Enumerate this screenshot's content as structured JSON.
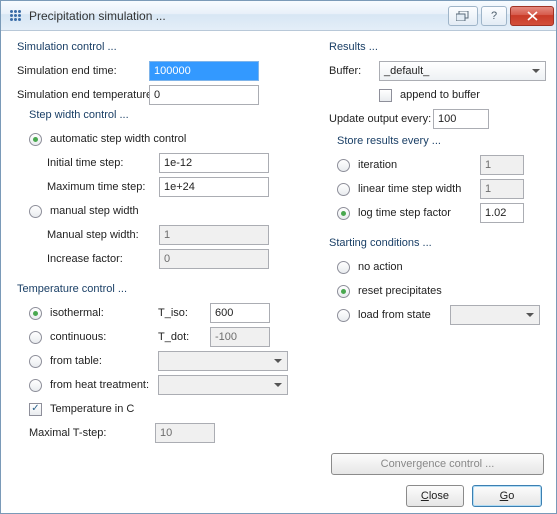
{
  "window": {
    "title": "Precipitation simulation ..."
  },
  "sim_control": {
    "title": "Simulation control ...",
    "end_time_label": "Simulation end time:",
    "end_time_value": "100000",
    "end_temp_label": "Simulation end temperature:",
    "end_temp_value": "0",
    "step_width": {
      "title": "Step width control ...",
      "mode": "automatic",
      "auto_label": "automatic step width  control",
      "initial_label": "Initial time step:",
      "initial_value": "1e-12",
      "max_label": "Maximum time step:",
      "max_value": "1e+24",
      "manual_label": "manual step width",
      "manual_width_label": "Manual step width:",
      "manual_width_value": "1",
      "increase_label": "Increase factor:",
      "increase_value": "0"
    }
  },
  "temp_control": {
    "title": "Temperature control ...",
    "mode": "isothermal",
    "isothermal_label": "isothermal:",
    "tiso_label": "T_iso:",
    "tiso_value": "600",
    "continuous_label": "continuous:",
    "tdot_label": "T_dot:",
    "tdot_value": "-100",
    "from_table_label": "from table:",
    "from_table_value": "",
    "from_heat_label": "from heat treatment:",
    "from_heat_value": "",
    "temp_in_c_label": "Temperature in C",
    "temp_in_c_checked": true,
    "max_tstep_label": "Maximal T-step:",
    "max_tstep_value": "10"
  },
  "results": {
    "title": "Results ...",
    "buffer_label": "Buffer:",
    "buffer_value": "_default_",
    "append_label": "append to buffer",
    "append_checked": false,
    "update_label": "Update output every:",
    "update_value": "100",
    "store": {
      "title": "Store results every ...",
      "mode": "log",
      "iteration_label": "iteration",
      "iteration_value": "1",
      "linear_label": "linear time step width",
      "linear_value": "1",
      "log_label": "log time step factor",
      "log_value": "1.02"
    }
  },
  "starting": {
    "title": "Starting conditions ...",
    "mode": "reset",
    "no_action_label": "no action",
    "reset_label": "reset precipitates",
    "load_label": "load from state",
    "load_value": ""
  },
  "buttons": {
    "convergence": "Convergence control ...",
    "close_pre": "",
    "close_accel": "C",
    "close_post": "lose",
    "go_pre": "",
    "go_accel": "G",
    "go_post": "o"
  }
}
